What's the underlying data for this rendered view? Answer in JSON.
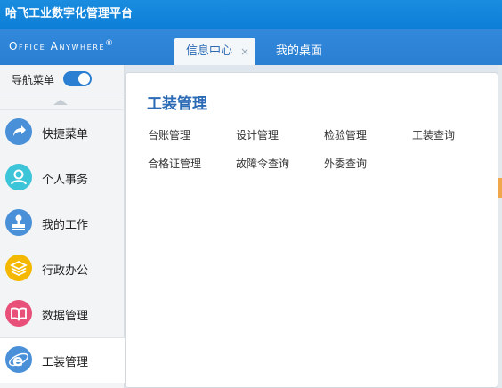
{
  "app": {
    "title": "哈飞工业数字化管理平台"
  },
  "brand": {
    "name": "Office Anywhere",
    "mark": "®"
  },
  "tabs": [
    {
      "label": "信息中心",
      "close": "×"
    },
    {
      "label": "我的桌面"
    }
  ],
  "sidebar": {
    "toggle_label": "导航菜单",
    "items": [
      {
        "label": "快捷菜单",
        "icon": "share-arrow-icon",
        "color": "#4a90d9"
      },
      {
        "label": "个人事务",
        "icon": "person-icon",
        "color": "#3cc4d8"
      },
      {
        "label": "我的工作",
        "icon": "stamp-icon",
        "color": "#4a90d9"
      },
      {
        "label": "行政办公",
        "icon": "layers-icon",
        "color": "#f5b800"
      },
      {
        "label": "数据管理",
        "icon": "book-icon",
        "color": "#e8507a"
      },
      {
        "label": "工装管理",
        "icon": "ie-icon",
        "color": "#4a90d9"
      }
    ]
  },
  "main": {
    "section_title": "工装管理",
    "links": [
      "台账管理",
      "设计管理",
      "检验管理",
      "工装查询",
      "合格证管理",
      "故障令查询",
      "外委查询"
    ]
  }
}
